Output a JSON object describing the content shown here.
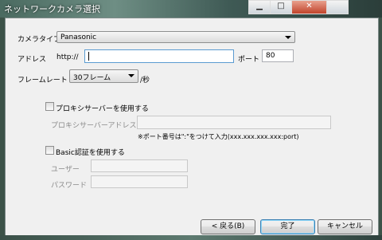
{
  "window": {
    "title": "ネットワークカメラ選択"
  },
  "form": {
    "camera_type_label": "カメラタイプ",
    "camera_type_value": "Panasonic",
    "address_label": "アドレス",
    "http_prefix": "http://",
    "address_value": "",
    "port_label": "ポート",
    "port_value": "80",
    "framerate_label": "フレームレート",
    "framerate_value": "30フレーム",
    "framerate_unit": "/秒"
  },
  "proxy": {
    "checkbox_label": "プロキシサーバーを使用する",
    "checked": false,
    "address_label": "プロキシサーバーアドレス",
    "address_value": "",
    "note": "※ポート番号は\":\"をつけて入力(xxx.xxx.xxx.xxx:port)"
  },
  "basic_auth": {
    "checkbox_label": "Basic認証を使用する",
    "checked": false,
    "user_label": "ユーザー",
    "user_value": "",
    "password_label": "パスワード",
    "password_value": ""
  },
  "buttons": {
    "back": "< 戻る(B)",
    "finish": "完了",
    "cancel": "キャンセル"
  }
}
